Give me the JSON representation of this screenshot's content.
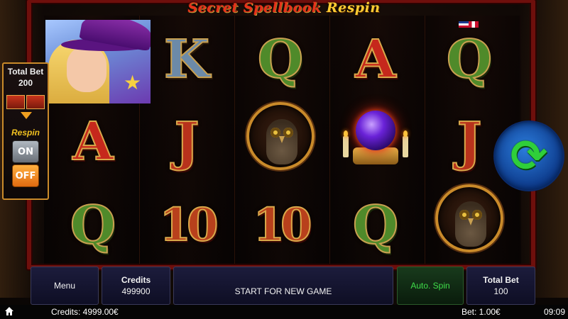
{
  "game": {
    "title_main": "Secret Spellbook",
    "title_suffix": "Respin"
  },
  "reels": {
    "columns": [
      [
        "witch-wild",
        "A",
        "Q"
      ],
      [
        "K",
        "J",
        "10"
      ],
      [
        "Q",
        "owl",
        "10"
      ],
      [
        "A",
        "crystal-orb",
        "Q"
      ],
      [
        "Q",
        "J",
        "owl"
      ]
    ]
  },
  "side_panel": {
    "total_bet_label": "Total Bet",
    "total_bet_value": "200",
    "respin_label": "Respin",
    "on_label": "ON",
    "off_label": "OFF"
  },
  "controls": {
    "menu_label": "Menu",
    "credits_label": "Credits",
    "credits_value": "499900",
    "start_label": "START FOR NEW GAME",
    "auto_spin_label": "Auto. Spin",
    "total_bet_label": "Total Bet",
    "total_bet_value": "100"
  },
  "status_bar": {
    "credits": "Credits: 4999.00€",
    "bet": "Bet: 1.00€",
    "time": "09:09"
  },
  "colors": {
    "spin_green": "#2fcf3a",
    "frame_red": "#6e0f0c",
    "accent_gold": "#c98a2a"
  },
  "icons": [
    "home-icon",
    "spin-icon",
    "flag-uk-icon",
    "flag-de-icon"
  ]
}
